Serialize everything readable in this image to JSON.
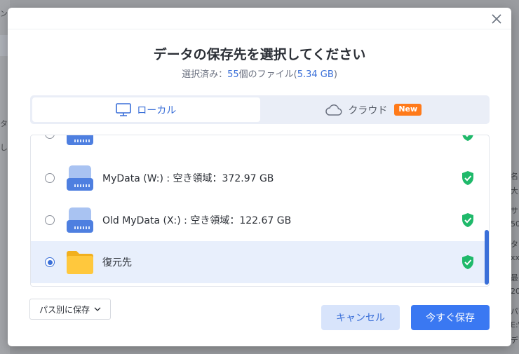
{
  "background": {
    "left_fragments": [
      "ンの",
      "タ",
      "し"
    ],
    "right_fragments": [
      "名",
      "大",
      "サ",
      "50",
      "タ",
      "xx",
      "最",
      "20",
      "パ",
      "E:\\",
      "デ"
    ]
  },
  "dialog": {
    "close_icon": "close-icon",
    "title": "データの保存先を選択してください",
    "subtitle_prefix": "選択済み：",
    "subtitle_count": "55",
    "subtitle_mid": "個のファイル(",
    "subtitle_size": "5.34 GB",
    "subtitle_suffix": ")"
  },
  "tabs": [
    {
      "label": "ローカル",
      "icon": "monitor-icon",
      "active": true
    },
    {
      "label": "クラウド",
      "icon": "cloud-icon",
      "active": false,
      "badge": "New"
    }
  ],
  "list": {
    "items": [
      {
        "label": "",
        "icon": "drive-icon",
        "selected": false,
        "status_icon": "shield-check-icon"
      },
      {
        "label": "MyData (W:) : 空き領域：372.97 GB",
        "icon": "drive-icon",
        "selected": false,
        "status_icon": "shield-check-icon"
      },
      {
        "label": "Old MyData (X:) : 空き領域：122.67 GB",
        "icon": "drive-icon",
        "selected": false,
        "status_icon": "shield-check-icon"
      },
      {
        "label": "復元先",
        "icon": "folder-icon",
        "selected": true,
        "status_icon": "shield-check-icon"
      }
    ]
  },
  "footer": {
    "path_button": "パス別に保存",
    "cancel_button": "キャンセル",
    "save_button": "今すぐ保存"
  },
  "colors": {
    "accent": "#3a6fd8",
    "primary_button": "#3a78f2",
    "badge": "#ff7a1a",
    "shield": "#1fb96a",
    "selected_row": "#e8effc"
  }
}
